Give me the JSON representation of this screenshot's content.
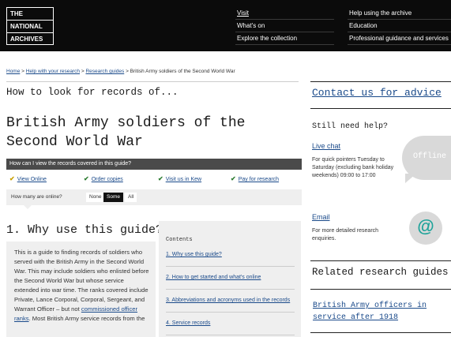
{
  "header": {
    "logo_lines": [
      "THE",
      "NATIONAL",
      "ARCHIVES"
    ],
    "nav_primary": [
      "Visit",
      "What's on",
      "Explore the collection"
    ],
    "nav_secondary": [
      "Help using the archive",
      "Education",
      "Professional guidance and services"
    ]
  },
  "breadcrumb": {
    "items": [
      "Home",
      "Help with your research",
      "Research guides"
    ],
    "separator": ">",
    "current": "British Army soldiers of the Second World War"
  },
  "page": {
    "kicker": "How to look for records of...",
    "title": "British Army soldiers of the Second World War"
  },
  "view_options": {
    "heading": "How can I view the records covered in this guide?",
    "options": [
      {
        "label": "View Online",
        "icon": "check-icon",
        "color": "#c8a000"
      },
      {
        "label": "Order copies",
        "icon": "check-icon",
        "color": "#2e7d32"
      },
      {
        "label": "Visit us in Kew",
        "icon": "check-icon",
        "color": "#2e7d32"
      },
      {
        "label": "Pay for research",
        "icon": "check-icon",
        "color": "#2e7d32"
      }
    ],
    "online_label": "How many are online?",
    "online_choices": [
      "None",
      "Some",
      "All"
    ],
    "online_selected": "Some"
  },
  "section1": {
    "heading": "1. Why use this guide?",
    "body_pre": "This is a guide to finding records of soldiers who served with the British Army in the Second World War. This may include soldiers who enlisted before the Second World War but whose service extended into war time. The ranks covered include Private, Lance Corporal, Corporal, Sergeant, and Warrant Officer – but not ",
    "body_link": "commissioned officer ranks",
    "body_post": ". Most British Army service records from the"
  },
  "contents": {
    "heading": "Contents",
    "items": [
      "1. Why use this guide?",
      "2. How to get started and what's online",
      "3. Abbreviations and acronyms used in the records",
      "4. Service records"
    ]
  },
  "sidebar": {
    "contact_title": "Contact us for advice",
    "still_help": "Still need help?",
    "live_chat": {
      "label": "Live chat",
      "text": "For quick pointers Tuesday to Saturday (excluding bank holiday weekends) 09:00 to 17:00",
      "status": "Offline"
    },
    "email": {
      "label": "Email",
      "text": "For more detailed research enquiries.",
      "icon_glyph": "@"
    },
    "related_title": "Related research guides",
    "related_links": [
      "British Army officers in service after 1918"
    ]
  }
}
